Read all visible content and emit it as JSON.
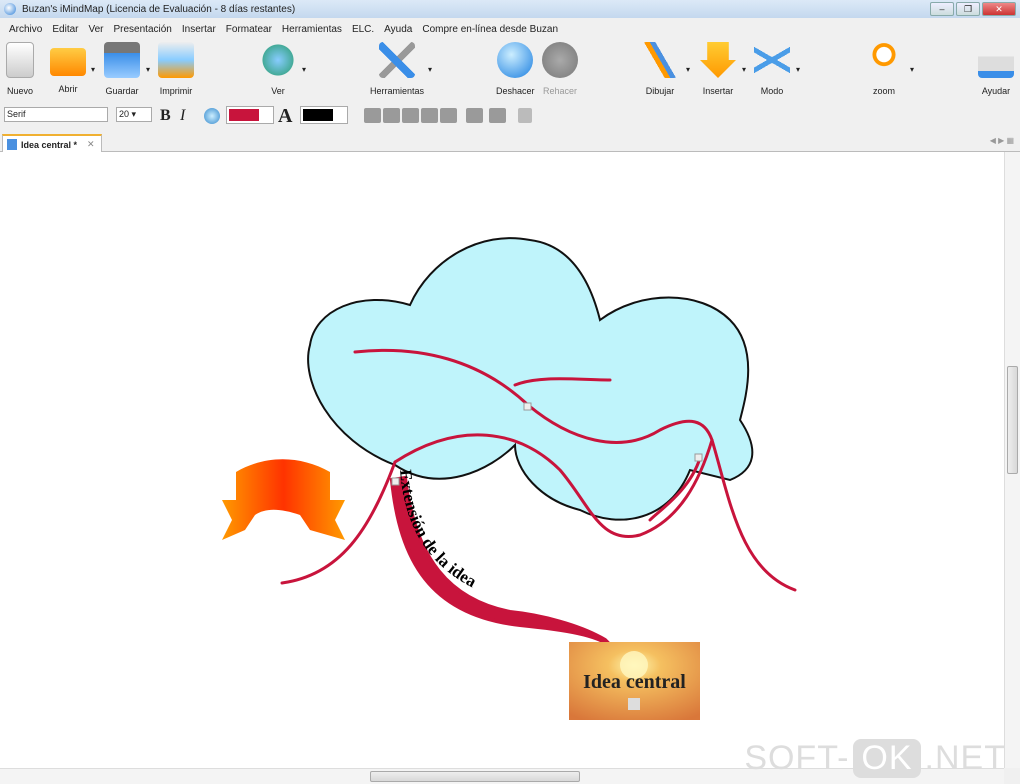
{
  "window": {
    "title": "Buzan's iMindMap (Licencia de Evaluación -   8 días restantes)",
    "min": "–",
    "max": "❐",
    "close": "✕"
  },
  "menu": [
    "Archivo",
    "Editar",
    "Ver",
    "Presentación",
    "Insertar",
    "Formatear",
    "Herramientas",
    "ELC.",
    "Ayuda",
    "Compre en-línea desde Buzan"
  ],
  "toolbar": {
    "nuevo": "Nuevo",
    "abrir": "Abrir",
    "guardar": "Guardar",
    "imprimir": "Imprimir",
    "ver": "Ver",
    "herramientas": "Herramientas",
    "deshacer": "Deshacer",
    "rehacer": "Rehacer",
    "dibujar": "Dibujar",
    "insertar": "Insertar",
    "modo": "Modo",
    "zoom": "zoom",
    "ayudar": "Ayudar",
    "drop": "▾"
  },
  "format": {
    "font": "Serif",
    "size": "20",
    "bold": "B",
    "italic": "I",
    "text_a": "A",
    "fill_color": "#c8143c",
    "text_color": "#000000"
  },
  "tab": {
    "label": "Idea central *",
    "close": "✕"
  },
  "map": {
    "central": "Idea central",
    "branch": "Extensión de la idea"
  },
  "colors": {
    "branch": "#c8143c",
    "cloud": "#bff4fb"
  },
  "watermark": {
    "a": "SOFT-",
    "b": "OK",
    ".c": ".NET",
    "c": ".NET"
  }
}
